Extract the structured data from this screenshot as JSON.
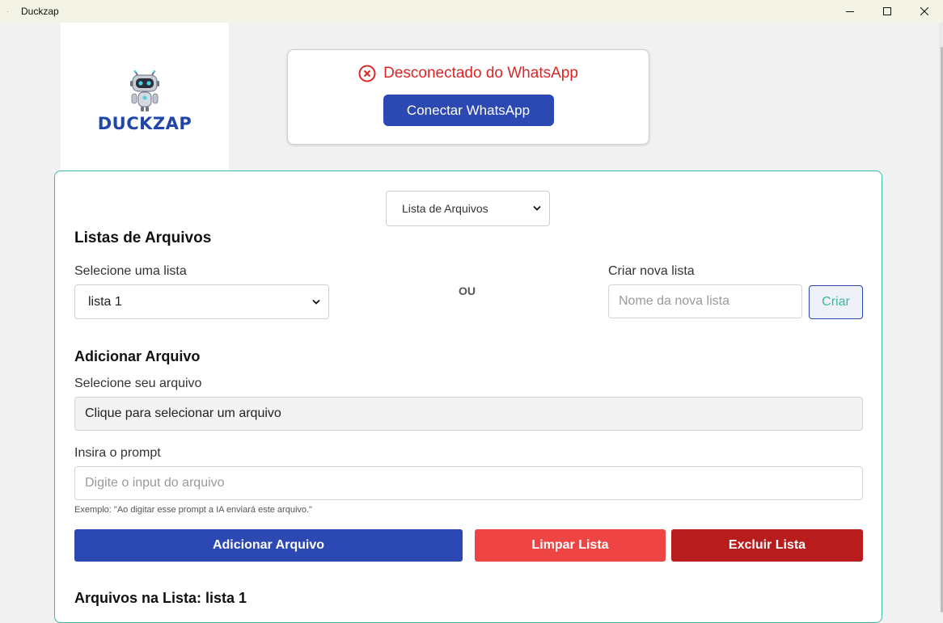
{
  "window": {
    "title": "Duckzap"
  },
  "logo": {
    "text": "DUCKZAP"
  },
  "status": {
    "text": "Desconectado do WhatsApp",
    "connect_label": "Conectar WhatsApp",
    "color": "#dc2626"
  },
  "mode_select": {
    "value": "Lista de Arquivos"
  },
  "lists": {
    "heading": "Listas de Arquivos",
    "select_label": "Selecione uma lista",
    "selected": "lista 1",
    "separator": "OU",
    "create_label": "Criar nova lista",
    "new_name_placeholder": "Nome da nova lista",
    "create_button": "Criar"
  },
  "add_file": {
    "heading": "Adicionar Arquivo",
    "file_label": "Selecione seu arquivo",
    "file_placeholder": "Clique para selecionar um arquivo",
    "prompt_label": "Insira o prompt",
    "prompt_placeholder": "Digite o input do arquivo",
    "hint": "Exemplo: \"Ao digitar esse prompt a IA enviará este arquivo.\"",
    "add_button": "Adicionar Arquivo",
    "clear_button": "Limpar Lista",
    "delete_button": "Excluir Lista"
  },
  "files_in_list": {
    "heading": "Arquivos na Lista: lista 1"
  },
  "colors": {
    "primary": "#2b48b3",
    "accent_border": "#3ab8a2",
    "danger": "#ef4444",
    "danger_dark": "#b91c1c"
  }
}
